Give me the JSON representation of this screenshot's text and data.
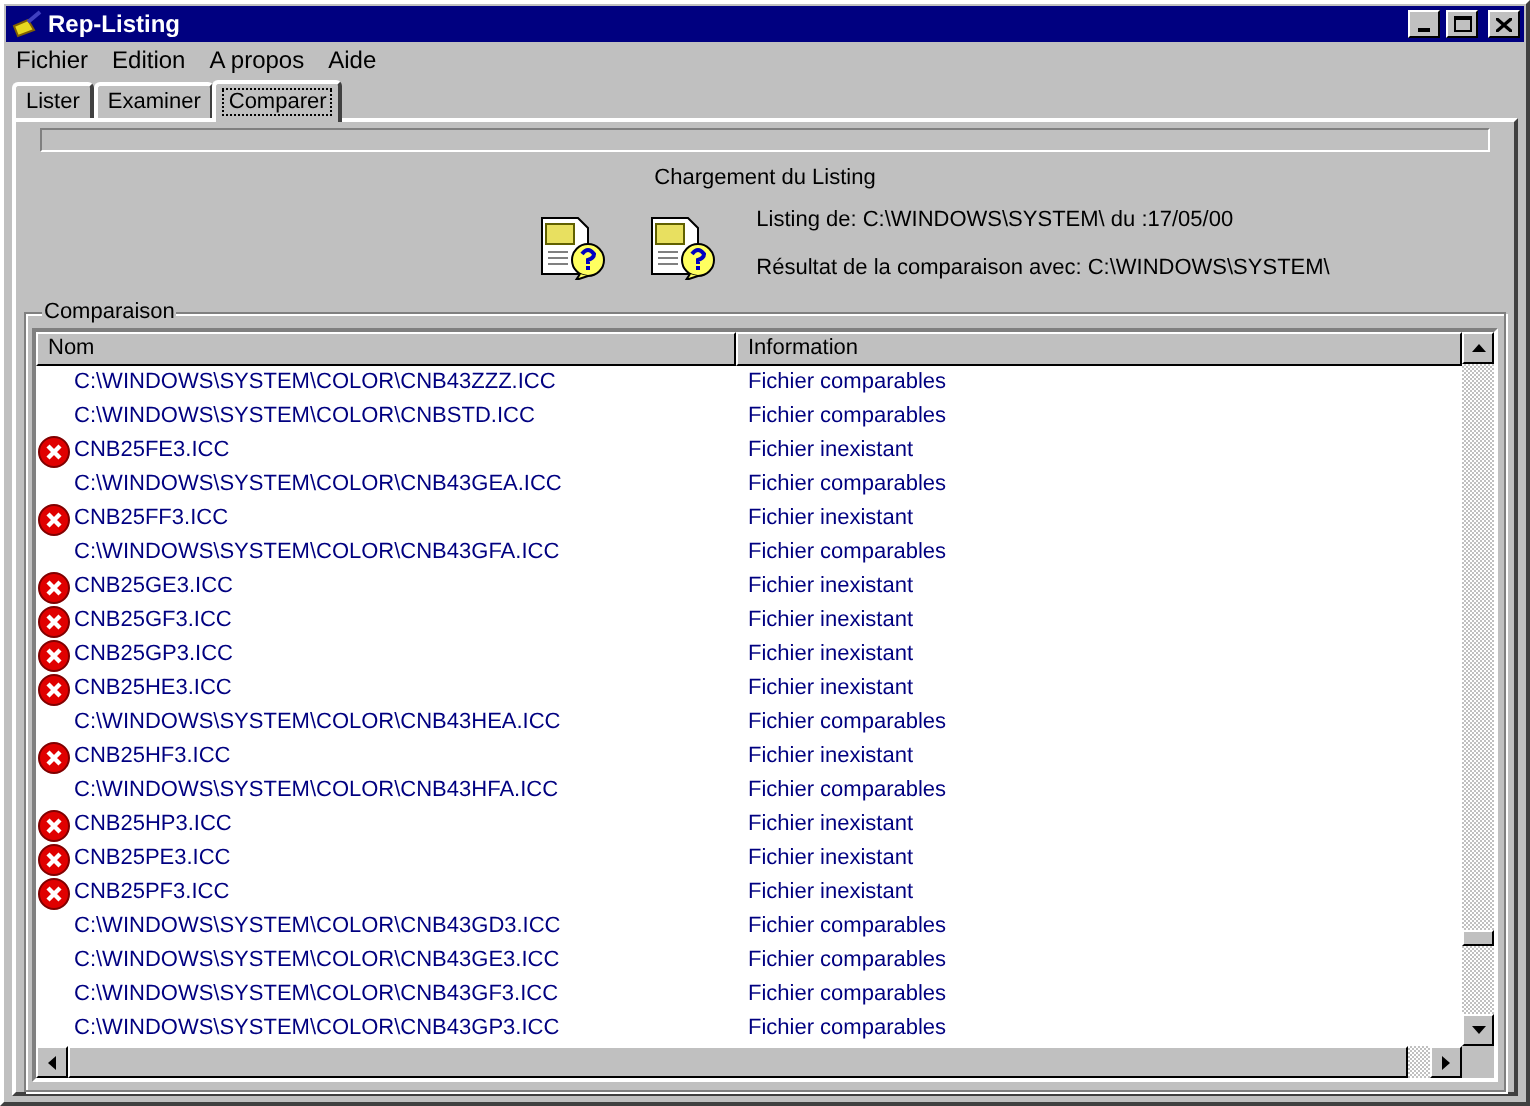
{
  "window": {
    "title": "Rep-Listing"
  },
  "menu": [
    "Fichier",
    "Edition",
    "A propos",
    "Aide"
  ],
  "tabs": [
    {
      "label": "Lister",
      "selected": false
    },
    {
      "label": "Examiner",
      "selected": false
    },
    {
      "label": "Comparer",
      "selected": true
    }
  ],
  "progress": {
    "level": 0
  },
  "loading": {
    "title": "Chargement du Listing",
    "listing_info": "Listing de: C:\\WINDOWS\\SYSTEM\\ du :17/05/00",
    "comparison_info": "Résultat de la comparaison avec: C:\\WINDOWS\\SYSTEM\\"
  },
  "comparison": {
    "title": "Comparaison",
    "columns": [
      "Nom",
      "Information"
    ],
    "rows": [
      {
        "error": false,
        "name": "C:\\WINDOWS\\SYSTEM\\COLOR\\CNB43ZZZ.ICC",
        "information": "Fichier comparables"
      },
      {
        "error": false,
        "name": "C:\\WINDOWS\\SYSTEM\\COLOR\\CNBSTD.ICC",
        "information": "Fichier comparables"
      },
      {
        "error": true,
        "name": "CNB25FE3.ICC",
        "information": "Fichier inexistant"
      },
      {
        "error": false,
        "name": "C:\\WINDOWS\\SYSTEM\\COLOR\\CNB43GEA.ICC",
        "information": "Fichier comparables"
      },
      {
        "error": true,
        "name": "CNB25FF3.ICC",
        "information": "Fichier inexistant"
      },
      {
        "error": false,
        "name": "C:\\WINDOWS\\SYSTEM\\COLOR\\CNB43GFA.ICC",
        "information": "Fichier comparables"
      },
      {
        "error": true,
        "name": "CNB25GE3.ICC",
        "information": "Fichier inexistant"
      },
      {
        "error": true,
        "name": "CNB25GF3.ICC",
        "information": "Fichier inexistant"
      },
      {
        "error": true,
        "name": "CNB25GP3.ICC",
        "information": "Fichier inexistant"
      },
      {
        "error": true,
        "name": "CNB25HE3.ICC",
        "information": "Fichier inexistant"
      },
      {
        "error": false,
        "name": "C:\\WINDOWS\\SYSTEM\\COLOR\\CNB43HEA.ICC",
        "information": "Fichier comparables"
      },
      {
        "error": true,
        "name": "CNB25HF3.ICC",
        "information": "Fichier inexistant"
      },
      {
        "error": false,
        "name": "C:\\WINDOWS\\SYSTEM\\COLOR\\CNB43HFA.ICC",
        "information": "Fichier comparables"
      },
      {
        "error": true,
        "name": "CNB25HP3.ICC",
        "information": "Fichier inexistant"
      },
      {
        "error": true,
        "name": "CNB25PE3.ICC",
        "information": "Fichier inexistant"
      },
      {
        "error": true,
        "name": "CNB25PF3.ICC",
        "information": "Fichier inexistant"
      },
      {
        "error": false,
        "name": "C:\\WINDOWS\\SYSTEM\\COLOR\\CNB43GD3.ICC",
        "information": "Fichier comparables"
      },
      {
        "error": false,
        "name": "C:\\WINDOWS\\SYSTEM\\COLOR\\CNB43GE3.ICC",
        "information": "Fichier comparables"
      },
      {
        "error": false,
        "name": "C:\\WINDOWS\\SYSTEM\\COLOR\\CNB43GF3.ICC",
        "information": "Fichier comparables"
      },
      {
        "error": false,
        "name": "C:\\WINDOWS\\SYSTEM\\COLOR\\CNB43GP3.ICC",
        "information": "Fichier comparables"
      }
    ]
  }
}
